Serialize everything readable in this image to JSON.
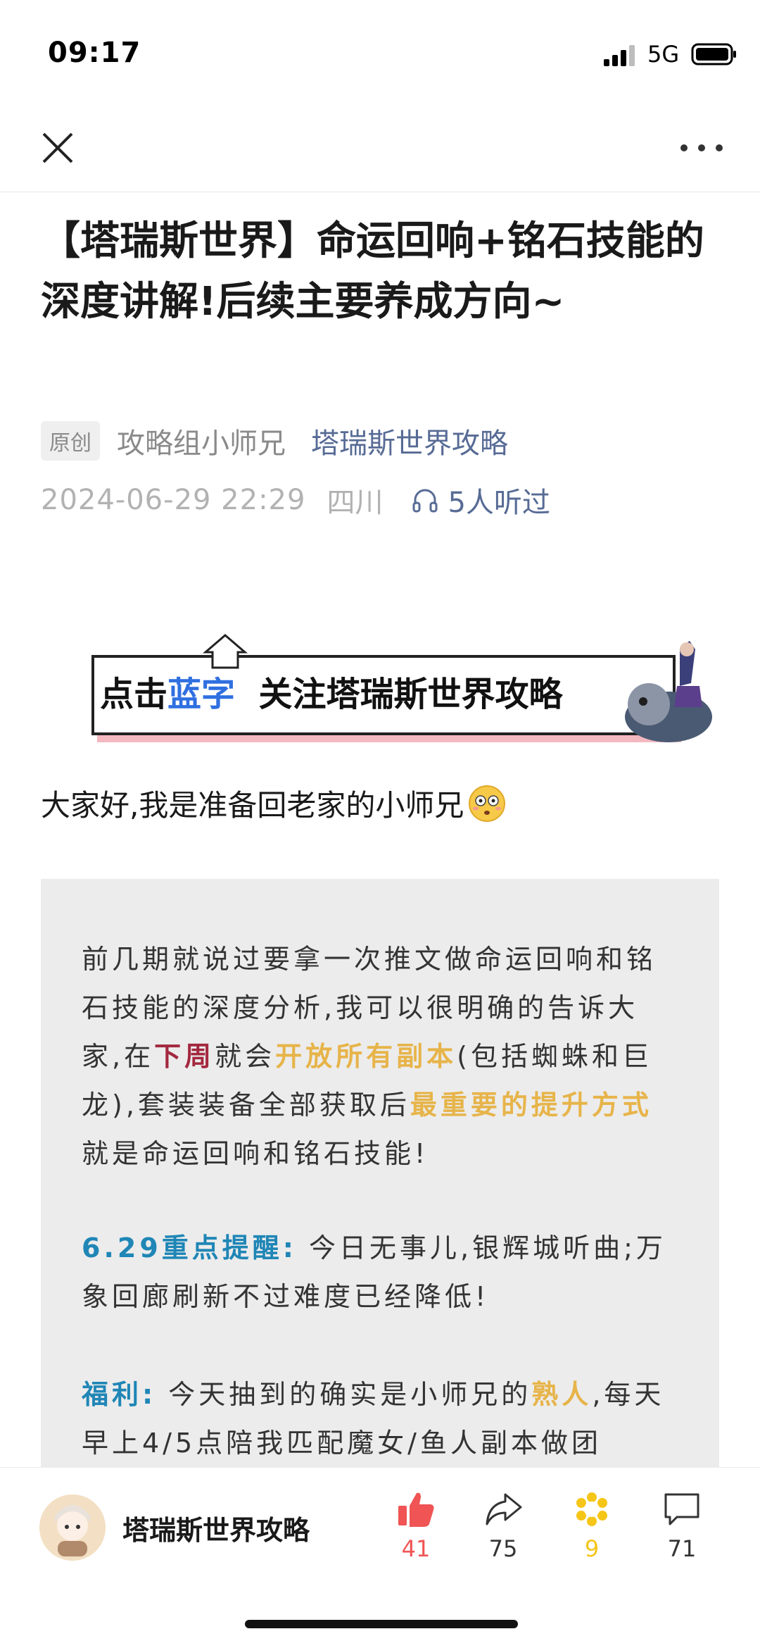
{
  "status_bar": {
    "time": "09:17",
    "network": "5G"
  },
  "nav": {
    "close_icon": "close-icon",
    "more_icon": "more-icon"
  },
  "article": {
    "title": "【塔瑞斯世界】命运回响+铭石技能的深度讲解!后续主要养成方向~",
    "original_tag": "原创",
    "author": "攻略组小师兄",
    "account": "塔瑞斯世界攻略",
    "date": "2024-06-29 22:29",
    "location": "四川",
    "listened": "5人听过"
  },
  "banner": {
    "prefix": "点击",
    "blue": "蓝字",
    "rest": "关注塔瑞斯世界攻略"
  },
  "greeting": "大家好,我是准备回老家的小师兄",
  "quote": {
    "p1": [
      {
        "t": "前几期就说过要拿一次推文做命运回响和铭石技能的深度分析,我可以很明确的告诉大家,在",
        "s": ""
      },
      {
        "t": "下周",
        "s": "red"
      },
      {
        "t": "就会",
        "s": ""
      },
      {
        "t": "开放所有副本",
        "s": "gold"
      },
      {
        "t": "(包括蜘蛛和巨龙),套装装备全部获取后",
        "s": ""
      },
      {
        "t": "最重要的提升方式",
        "s": "gold"
      },
      {
        "t": "就是命运回响和铭石技能!",
        "s": ""
      }
    ],
    "p2": [
      {
        "t": "6.29重点提醒:",
        "s": "teal"
      },
      {
        "t": " 今日无事儿,银辉城听曲;万象回廊刷新不过难度已经降低!",
        "s": ""
      }
    ],
    "p3": [
      {
        "t": "福利:",
        "s": "teal"
      },
      {
        "t": " 今天抽到的确实是小师兄的",
        "s": ""
      },
      {
        "t": "熟人",
        "s": "gold"
      },
      {
        "t": ",每天早上4/5点陪我匹配魔女/鱼人副本做团",
        "s": ""
      }
    ]
  },
  "bottom_bar": {
    "account_name": "塔瑞斯世界攻略",
    "like_count": "41",
    "share_count": "75",
    "favorite_count": "9",
    "comment_count": "71",
    "colors": {
      "like": "#f05454",
      "favorite": "#f5c518",
      "default": "#333333"
    }
  }
}
